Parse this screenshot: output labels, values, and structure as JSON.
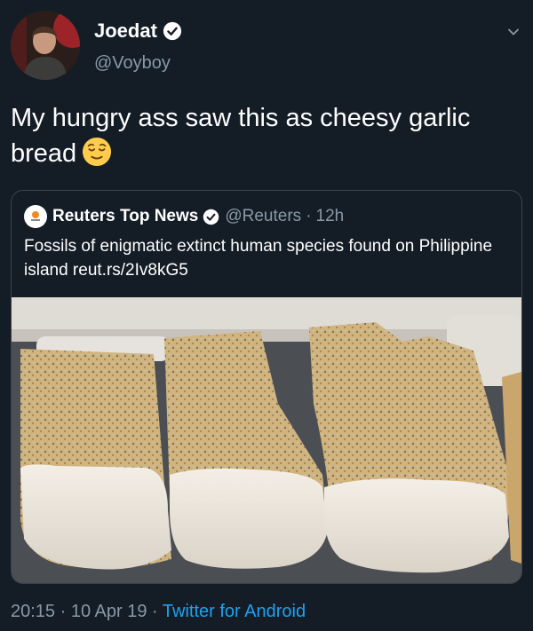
{
  "author": {
    "display_name": "Joedat",
    "handle": "@Voyboy",
    "verified": true,
    "avatar_icon": "profile-photo"
  },
  "tweet": {
    "text": "My hungry ass saw this as cheesy garlic bread",
    "emoji": "relieved-face"
  },
  "quoted": {
    "display_name": "Reuters Top News",
    "handle": "@Reuters",
    "separator": "·",
    "time": "12h",
    "verified": true,
    "text": "Fossils of enigmatic extinct human species found on Philippine island reut.rs/2Iv8kG5",
    "image_icon": "fossil-teeth-photo"
  },
  "meta": {
    "time": "20:15",
    "sep1": "·",
    "date": "10 Apr 19",
    "sep2": "·",
    "source": "Twitter for Android"
  },
  "colors": {
    "background": "#141d26",
    "muted": "#8899a6",
    "link": "#1da1f2",
    "border": "#38444d"
  }
}
